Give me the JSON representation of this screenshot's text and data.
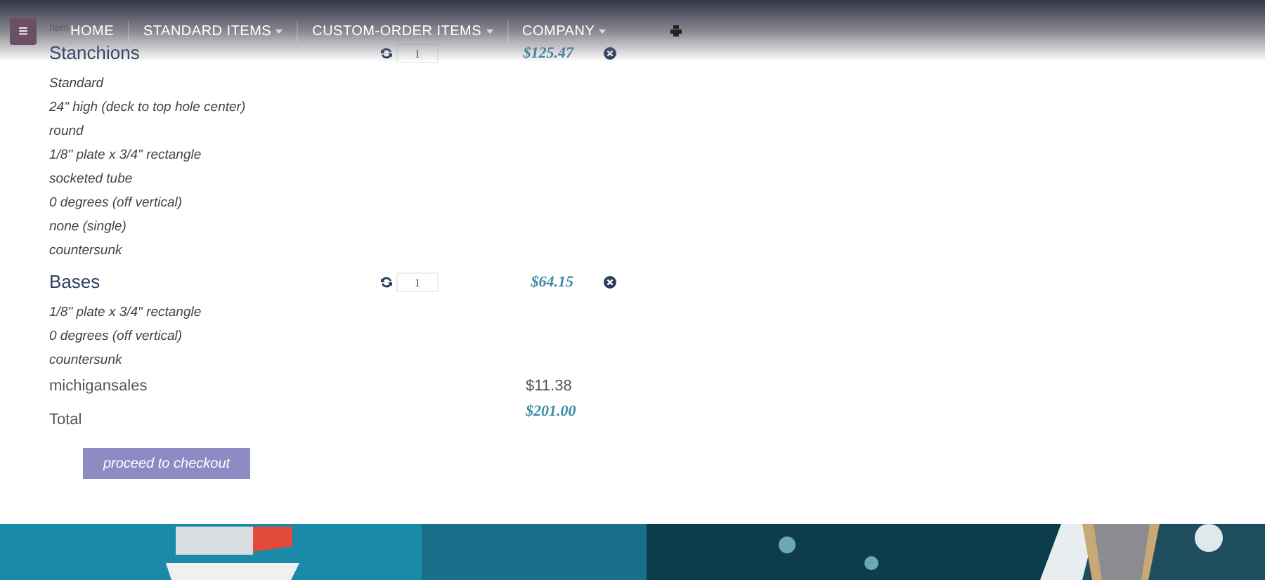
{
  "nav": {
    "menu_icon": "≡",
    "items": [
      {
        "label": "HOME",
        "dropdown": false
      },
      {
        "label": "STANDARD ITEMS",
        "dropdown": true
      },
      {
        "label": "CUSTOM-ORDER ITEMS",
        "dropdown": true
      },
      {
        "label": "COMPANY",
        "dropdown": true
      }
    ]
  },
  "cart": {
    "header_item": "Item",
    "items": [
      {
        "name": "Stanchions",
        "quantity": "1",
        "price": "$125.47",
        "options": [
          "Standard",
          "24\" high (deck to top hole center)",
          "round",
          "1/8\" plate x 3/4\" rectangle",
          "socketed tube",
          "0 degrees (off vertical)",
          "none (single)",
          "countersunk"
        ]
      },
      {
        "name": "Bases",
        "quantity": "1",
        "price": "$64.15",
        "options": [
          "1/8\" plate x 3/4\" rectangle",
          "0 degrees (off vertical)",
          "countersunk"
        ]
      }
    ],
    "shipping": {
      "label": "michigansales",
      "price": "$11.38"
    },
    "total": {
      "label": "Total",
      "price": "$201.00"
    },
    "checkout_button": "proceed to checkout"
  }
}
